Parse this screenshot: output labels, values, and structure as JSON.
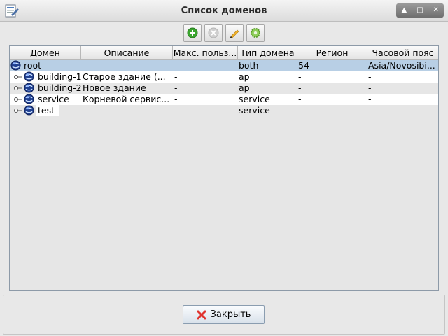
{
  "window": {
    "title": "Список доменов"
  },
  "icons": {
    "app": "document-edit-icon",
    "add": "add-icon",
    "delete": "delete-icon",
    "edit": "pencil-icon",
    "settings": "gear-icon",
    "domain": "globe-icon",
    "close": "close-x-icon"
  },
  "table": {
    "columns": [
      "Домен",
      "Описание",
      "Макс. польз...",
      "Тип домена",
      "Регион",
      "Часовой пояс"
    ],
    "rows": [
      {
        "domain": "root",
        "description": "",
        "max_users": "-",
        "type": "both",
        "region": "54",
        "timezone": "Asia/Novosibi..."
      },
      {
        "domain": "building-1",
        "description": "Старое здание (...",
        "max_users": "-",
        "type": "ap",
        "region": "-",
        "timezone": "-"
      },
      {
        "domain": "building-2",
        "description": "Новое здание",
        "max_users": "-",
        "type": "ap",
        "region": "-",
        "timezone": "-"
      },
      {
        "domain": "service",
        "description": "Корневой сервис...",
        "max_users": "-",
        "type": "service",
        "region": "-",
        "timezone": "-"
      },
      {
        "domain": "test",
        "description": "",
        "max_users": "-",
        "type": "service",
        "region": "-",
        "timezone": "-"
      }
    ]
  },
  "footer": {
    "close_label": "Закрыть"
  },
  "colors": {
    "selection": "#b8cfe5",
    "close_red": "#e0322d",
    "add_green": "#3aa52e"
  }
}
